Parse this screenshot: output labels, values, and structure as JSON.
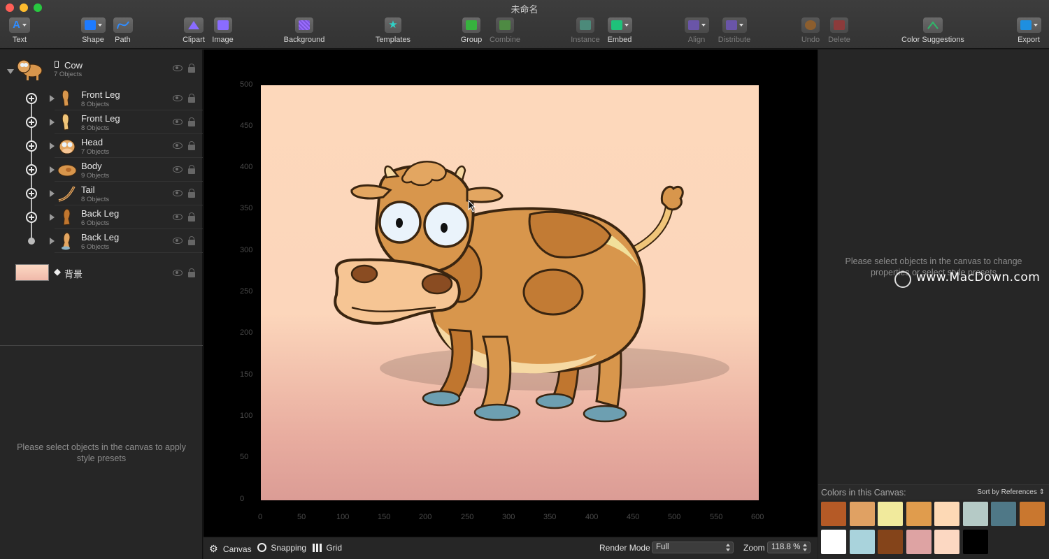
{
  "window": {
    "title": "未命名"
  },
  "toolbar": [
    {
      "label": "Text",
      "icon": "text-icon",
      "enabled": true
    },
    {
      "label": "Shape",
      "icon": "shape-icon",
      "enabled": true
    },
    {
      "label": "Path",
      "icon": "path-icon",
      "enabled": true
    },
    {
      "label": "Clipart",
      "icon": "clipart-icon",
      "enabled": true
    },
    {
      "label": "Image",
      "icon": "image-icon",
      "enabled": true
    },
    {
      "label": "Background",
      "icon": "background-icon",
      "enabled": true
    },
    {
      "label": "Templates",
      "icon": "templates-star-icon",
      "enabled": true
    },
    {
      "label": "Group",
      "icon": "group-icon",
      "enabled": true
    },
    {
      "label": "Combine",
      "icon": "combine-icon",
      "enabled": false
    },
    {
      "label": "Instance",
      "icon": "instance-icon",
      "enabled": false
    },
    {
      "label": "Embed",
      "icon": "embed-icon",
      "enabled": true
    },
    {
      "label": "Align",
      "icon": "align-icon",
      "enabled": false
    },
    {
      "label": "Distribute",
      "icon": "distribute-icon",
      "enabled": false
    },
    {
      "label": "Undo",
      "icon": "undo-icon",
      "enabled": false
    },
    {
      "label": "Delete",
      "icon": "delete-icon",
      "enabled": false
    },
    {
      "label": "Color Suggestions",
      "icon": "color-suggestions-icon",
      "enabled": true
    },
    {
      "label": "Export",
      "icon": "export-icon",
      "enabled": true
    }
  ],
  "layers": {
    "root": {
      "name": "Cow",
      "count": "7 Objects"
    },
    "children": [
      {
        "name": "Front Leg",
        "count": "8 Objects"
      },
      {
        "name": "Front Leg",
        "count": "8 Objects"
      },
      {
        "name": "Head",
        "count": "7 Objects"
      },
      {
        "name": "Body",
        "count": "9 Objects"
      },
      {
        "name": "Tail",
        "count": "8 Objects"
      },
      {
        "name": "Back Leg",
        "count": "6 Objects"
      },
      {
        "name": "Back Leg",
        "count": "6 Objects"
      }
    ],
    "background": {
      "name": "背景"
    }
  },
  "style_hint": "Please select objects in the canvas to apply style presets",
  "ruler": {
    "x_ticks": [
      "0",
      "50",
      "100",
      "150",
      "200",
      "250",
      "300",
      "350",
      "400",
      "450",
      "500",
      "550",
      "600"
    ],
    "y_ticks": [
      "500",
      "450",
      "400",
      "350",
      "300",
      "250",
      "200",
      "150",
      "100",
      "50",
      "0"
    ]
  },
  "bottom_bar": {
    "canvas_label": "Canvas",
    "snapping_label": "Snapping",
    "grid_label": "Grid",
    "render_mode_label": "Render Mode",
    "render_mode_value": "Full",
    "zoom_label": "Zoom",
    "zoom_value": "118.8 %"
  },
  "properties_hint": "Please select objects in the canvas to change properties or select style presets",
  "watermark": "www.MacDown.com",
  "canvas_colors": {
    "title": "Colors in this Canvas:",
    "sort": "Sort by References",
    "swatches": [
      "#b55a26",
      "#e0a163",
      "#f1ea9c",
      "#e09c4d",
      "#fdd9b5",
      "#b5cac6",
      "#4f7887",
      "#c9772f",
      "#ffffff",
      "#a9d3dc",
      "#84441a",
      "#dea3a3",
      "#fcd8c2",
      "#000000"
    ]
  }
}
